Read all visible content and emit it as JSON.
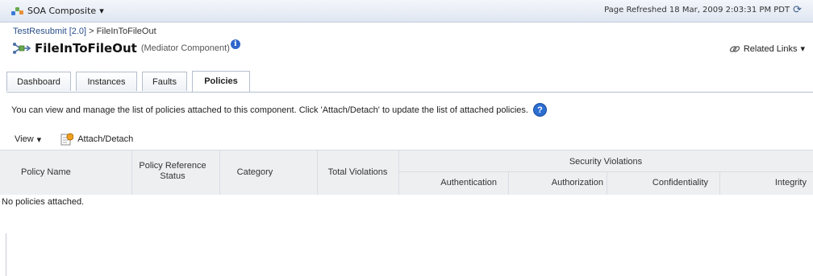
{
  "header": {
    "menu_label": "SOA Composite",
    "refresh_text": "Page Refreshed 18 Mar, 2009 2:03:31 PM PDT"
  },
  "breadcrumb": {
    "link": "TestResubmit [2.0]",
    "separator": ">",
    "current": "FileInToFileOut"
  },
  "component": {
    "name": "FileInToFileOut",
    "type": "(Mediator Component)",
    "info_glyph": "i"
  },
  "related_links": "Related Links",
  "tabs": [
    {
      "label": "Dashboard",
      "active": false
    },
    {
      "label": "Instances",
      "active": false
    },
    {
      "label": "Faults",
      "active": false
    },
    {
      "label": "Policies",
      "active": true
    }
  ],
  "description": "You can view and manage the list of policies attached to this component. Click 'Attach/Detach' to update the list of attached policies.",
  "help_glyph": "?",
  "toolbar": {
    "view_label": "View",
    "attach_label": "Attach/Detach"
  },
  "table": {
    "columns": {
      "policy_name": "Policy Name",
      "policy_ref_status": "Policy Reference Status",
      "category": "Category",
      "total_violations": "Total Violations",
      "security_violations": "Security Violations",
      "authentication": "Authentication",
      "authorization": "Authorization",
      "confidentiality": "Confidentiality",
      "integrity": "Integrity"
    },
    "empty_message": "No policies attached."
  },
  "icons": {
    "soa": "soa-composite-icon",
    "refresh": "refresh-icon",
    "component": "mediator-component-icon",
    "info": "info-icon",
    "related_links": "link-icon",
    "help": "help-icon",
    "attach": "attach-detach-icon"
  },
  "colors": {
    "link": "#2a4f8a",
    "accent": "#2d6ed1",
    "header_bg": "#dfe6f1",
    "grid_header_bg": "#eeeff1"
  }
}
